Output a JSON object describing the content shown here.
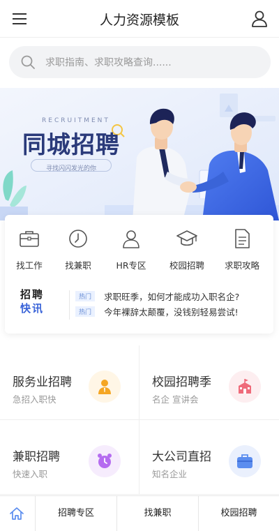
{
  "header": {
    "title": "人力资源模板"
  },
  "search": {
    "placeholder": "求职指南、求职攻略查询......"
  },
  "banner": {
    "small_title": "RECRUITMENT",
    "big_title": "同城招聘",
    "slogan": "寻找闪闪发光的你",
    "colors": {
      "bg": "#eaf1fc",
      "title": "#2a3a7a",
      "accent": "#3a64d8"
    }
  },
  "quick_nav": [
    {
      "label": "找工作",
      "icon": "briefcase-icon"
    },
    {
      "label": "找兼职",
      "icon": "clock-icon"
    },
    {
      "label": "HR专区",
      "icon": "person-icon"
    },
    {
      "label": "校园招聘",
      "icon": "graduation-cap-icon"
    },
    {
      "label": "求职攻略",
      "icon": "document-icon"
    }
  ],
  "news": {
    "logo_line1": "招聘",
    "logo_line2": "快讯",
    "items": [
      {
        "tag": "热门",
        "text": "求职旺季，如何才能成功入职名企?"
      },
      {
        "tag": "热门",
        "text": "今年裸辞太颠覆，没钱别轻易尝试!"
      }
    ]
  },
  "categories": [
    {
      "title": "服务业招聘",
      "subtitle": "急招入职快",
      "icon": "worker-icon",
      "color": "#f5a623",
      "bg": "#fff6e6"
    },
    {
      "title": "校园招聘季",
      "subtitle": "名企 宣讲会",
      "icon": "school-icon",
      "color": "#ef6b7a",
      "bg": "#fdeef0"
    },
    {
      "title": "兼职招聘",
      "subtitle": "快速入职",
      "icon": "alarm-clock-icon",
      "color": "#b56cf0",
      "bg": "#f6ecfd"
    },
    {
      "title": "大公司直招",
      "subtitle": "知名企业",
      "icon": "briefcase-icon",
      "color": "#5b8def",
      "bg": "#eaf0fd"
    }
  ],
  "tabbar": {
    "items": [
      "招聘专区",
      "找兼职",
      "校园招聘"
    ],
    "active_color": "#5b8def"
  }
}
